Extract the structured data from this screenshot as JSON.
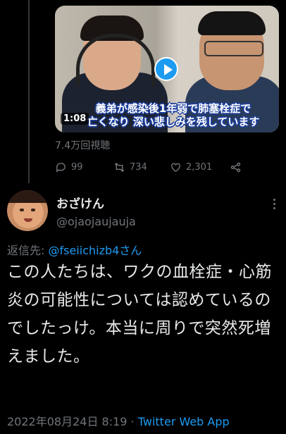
{
  "video": {
    "caption_line1": "義弟が感染後1年弱で肺塞栓症で",
    "caption_line2": "亡くなり 深い悲しみを残しています",
    "duration": "1:08",
    "play_icon": "play-icon"
  },
  "views": "7.4万回視聴",
  "actions": {
    "reply_count": "99",
    "retweet_count": "734",
    "like_count": "2,301",
    "icons": [
      "reply-icon",
      "retweet-icon",
      "heart-icon",
      "share-icon"
    ]
  },
  "author": {
    "display_name": "おざけん",
    "handle": "@ojaojaujauja"
  },
  "reply_to": {
    "prefix": "返信先: ",
    "target": "@fseiichizb4さん"
  },
  "tweet": {
    "text": "この人たちは、ワクの血栓症・心筋炎の可能性については認めているのでしたっけ。本当に周りで突然死増えました。"
  },
  "meta": {
    "timestamp": "2022年08月24日 8:19",
    "separator": " · ",
    "app": "Twitter Web App"
  },
  "colors": {
    "background": "#000000",
    "text": "#e7e9ea",
    "muted": "#71767b",
    "accent": "#1d9bf0"
  }
}
